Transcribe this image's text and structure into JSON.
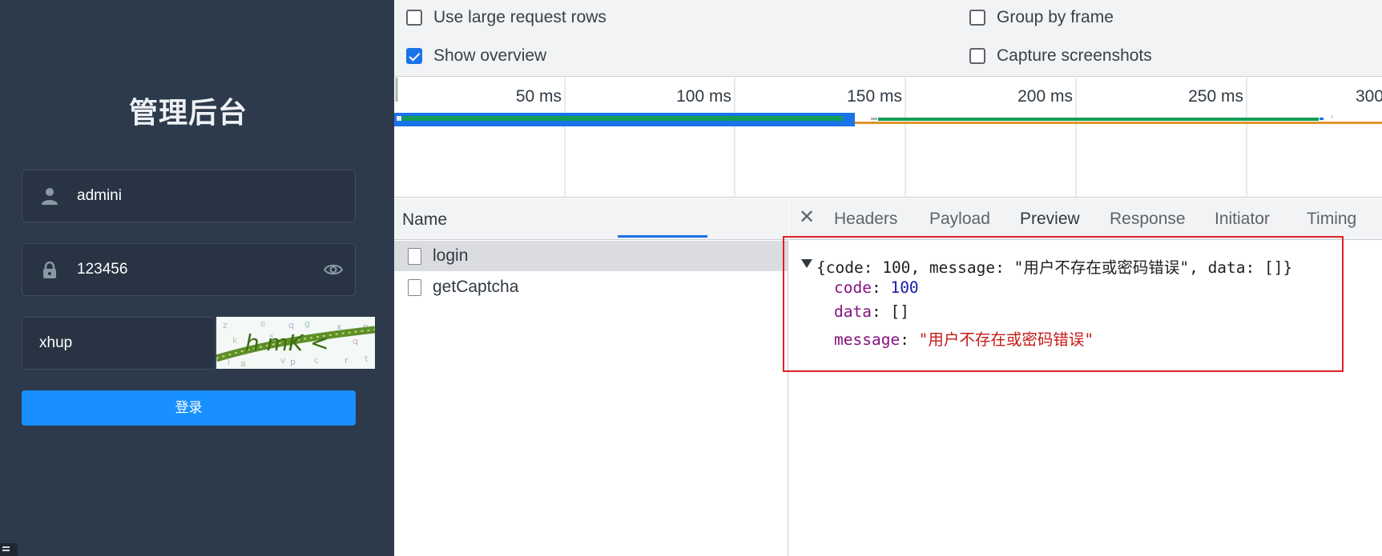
{
  "login": {
    "title": "管理后台",
    "username_value": "admini",
    "password_value": "123456",
    "captcha_value": "xhup",
    "captcha_image_text": "h mK <",
    "submit_label": "登录",
    "colors": {
      "panel_bg": "#2d3a4b",
      "button": "#1890ff"
    }
  },
  "devtools": {
    "settings": {
      "use_large_rows": {
        "label": "Use large request rows",
        "checked": false
      },
      "show_overview": {
        "label": "Show overview",
        "checked": true
      },
      "group_by_frame": {
        "label": "Group by frame",
        "checked": false
      },
      "capture_screenshots": {
        "label": "Capture screenshots",
        "checked": false
      }
    },
    "overview": {
      "ticks": [
        "50 ms",
        "100 ms",
        "150 ms",
        "200 ms",
        "250 ms",
        "300"
      ]
    },
    "requests": {
      "header": "Name",
      "items": [
        {
          "name": "login",
          "selected": true
        },
        {
          "name": "getCaptcha",
          "selected": false
        }
      ]
    },
    "detail": {
      "tabs": [
        "Headers",
        "Payload",
        "Preview",
        "Response",
        "Initiator",
        "Timing"
      ],
      "active_tab": "Preview",
      "preview": {
        "summary_open": "{",
        "summary_code_key": "code",
        "summary_code_val": "100",
        "summary_msg_key": "message",
        "summary_msg_val": "\"用户不存在或密码错误\"",
        "summary_data_key": "data",
        "summary_data_val": "[]",
        "summary_close": "}",
        "code_key": "code",
        "code_val": "100",
        "data_key": "data",
        "data_val": "[]",
        "message_key": "message",
        "message_val": "\"用户不存在或密码错误\""
      }
    },
    "colors": {
      "accent": "#1a73e8",
      "highlight_box": "#e32025",
      "key": "#881280",
      "number": "#1a1aa6",
      "string": "#c41a16"
    }
  }
}
